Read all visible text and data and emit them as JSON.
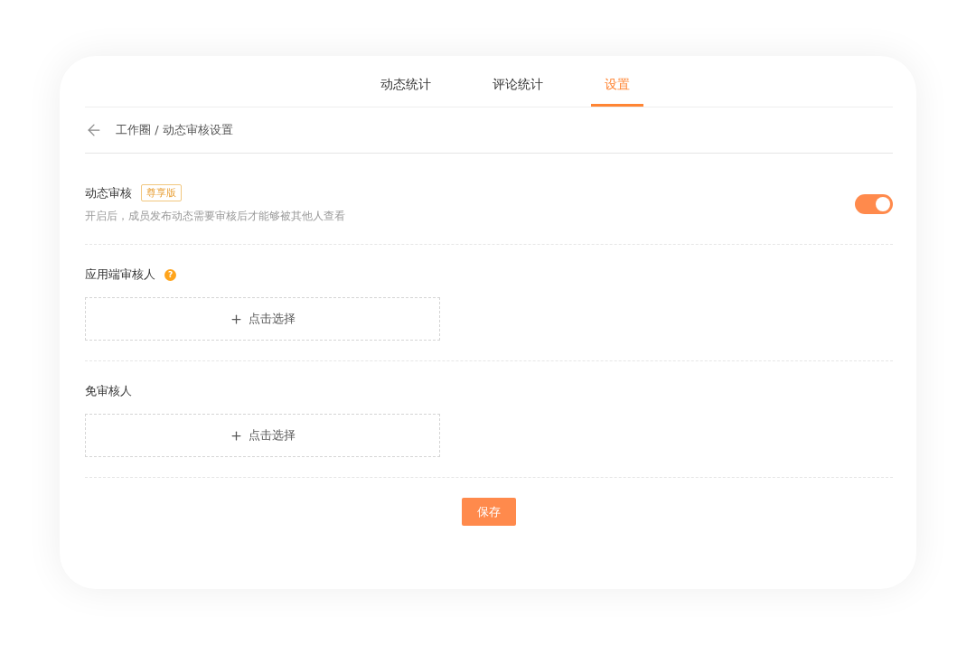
{
  "tabs": [
    {
      "label": "动态统计",
      "selected": false
    },
    {
      "label": "评论统计",
      "selected": false
    },
    {
      "label": "设置",
      "selected": true
    }
  ],
  "breadcrumb": "工作圈 / 动态审核设置",
  "review_setting": {
    "title": "动态审核",
    "badge": "尊享版",
    "description": "开启后，成员发布动态需要审核后才能够被其他人查看",
    "on": true
  },
  "pickers": [
    {
      "label": "应用端审核人",
      "help": "?",
      "button": "点击选择"
    },
    {
      "label": "免审核人",
      "button": "点击选择"
    }
  ],
  "save_button": "保存"
}
